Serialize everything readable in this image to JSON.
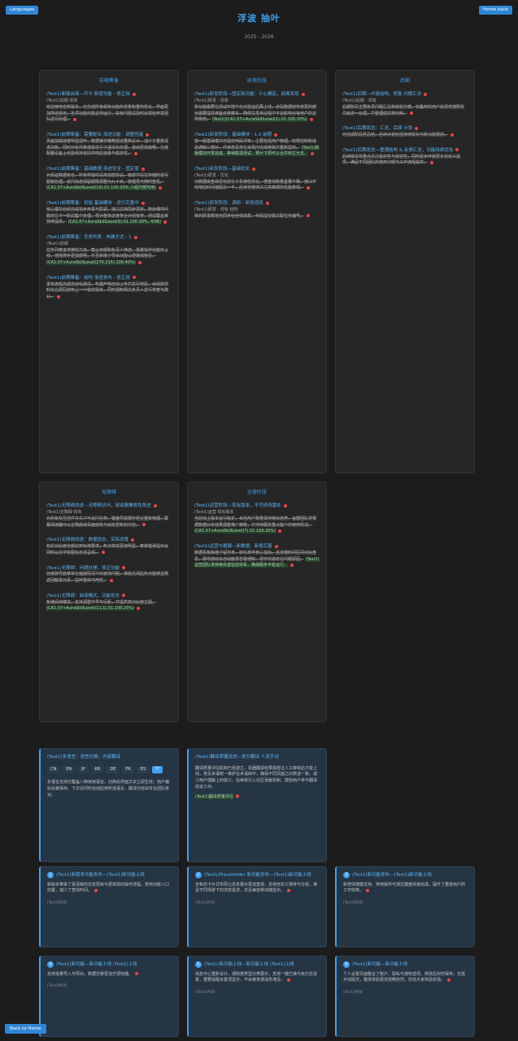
{
  "header": {
    "lang_button": "Languages",
    "home_button": "Home back",
    "title": "浮波 抽叶",
    "subtitle": "2025 - 2026"
  },
  "columns": [
    {
      "title": "前期筹备",
      "entries": [
        {
          "title": "(Test1)新版启用—开今 新增功能 - 修正用",
          "meta": "(Test1)前期 现有",
          "text": "欢迎使用全新版本，已完成所有现有功能的迁移和重构优化，界面更加简洁易用，各项功能均能正常运行，如有问题请及时反馈给开发团队进行处理。",
          "hl": ""
        },
        {
          "title": "(Test1)前期筹备：需要配合 渐进功能 - 调整性能",
          "meta": "",
          "text": "页面加载速度明显提升，数据缓存策略经过重新设计，减少了重复请求次数。同时对长列表渲染进行了虚拟化处理，滚动更加流畅，在低配置设备上也能保持良好的响应速度与稳定性。",
          "hl": ""
        },
        {
          "title": "(Test1)前期筹备：基础数据 渐进安全 - 固定版",
          "meta": "",
          "text": "为保证数据安全，所有传输均采用加密协议，敏感字段在存储时进行脱敏处理，访问日志保留期限调整为九十天，管理员可随时查看。",
          "hl": "(CA1.07+AuraSkillLevel(10).01.100.20%,小组内部可用)"
        },
        {
          "title": "(Test1)前期筹备：初始 基础模块 - 进行完善中",
          "meta": "",
          "text": "核心模块已经完成初步开发与联调，接口文档同步更新。剩余细节问题将在下一阶段集中处理，预计整体进度符合计划安排，测试覆盖率持续提高。",
          "hl": "(CA1.07+AuraSkillLevel(9).01.100.20%, 4/96)"
        },
        {
          "title": "(Test1)前期筹备：任务列表 - 构建方式 - 1",
          "meta": "(Test1)前期",
          "text": "任务列表支持按优先级、截止日期和负责人筛选，批量操作功能已上线，拖拽排序更加顺畅，并且新增了导出功能以便离线查看。",
          "hl": "(CA1.07+AuraSkillLevel(270.215).100.40%)"
        },
        {
          "title": "(Test1)前期筹备：结构 渐进发布 - 修正用",
          "meta": "",
          "text": "发布流程完成自动化改造，构建产物自动上传并进行校验，出现异常时会立即回滚到上一个稳定版本，同时通知相关负责人进行排查与确认。",
          "hl": ""
        }
      ]
    },
    {
      "title": "研发阶段",
      "entries": [
        {
          "title": "(Test1)研发阶段—固定新功能：小心确定，前面发现",
          "meta": "(Test1)研发 - 现有",
          "text": "新功能需要在测试环境中充分验证后再上线，涉及数据结构变更的部分需要提前准备迁移脚本，确保在发布过程中不会影响已有用户的正常使用。",
          "hl": "(Test1)(CA1.07+AuraSkillLevel(1).01.100.20%)"
        },
        {
          "title": "(Test1)研发阶段：基础模块 - 1.0 前期",
          "meta": "",
          "text": "第一版基础模块已提交代码评审，主要包括用户管理、权限控制和消息通知三部分，评审意见将在本周内完成修改并重新提交。",
          "hl": "(Test1)新版模块开发完成，等待联调测试，预计下周可以合并到主分支。"
        },
        {
          "title": "(Test1)研发阶段—基础优化",
          "meta": "(Test1)研发 - 优化",
          "text": "对数据库查询语句进行了系统性优化，慢查询数量显著下降，接口平均响应时间缩短近一半，后续将继续关注高峰期的性能表现。",
          "hl": ""
        },
        {
          "title": "(Test1)研发阶段：调研 - 研发现状",
          "meta": "(Test1)研发 - 现有 结构",
          "text": "新的研发规范已同步给全体成员，代码提交需关联任务编号。",
          "hl": ""
        }
      ]
    },
    {
      "title": "后期",
      "entries": [
        {
          "title": "(Test1)后期—内容结构，修复 问题汇总",
          "meta": "(Test1)后期 - 现有",
          "text": "后期阶段主要负责问题汇总和体验打磨，收集到的用户反馈将按照优先级逐一处理，并整理成文档归档。",
          "hl": ""
        },
        {
          "title": "(Test1)后期状态：汇总，后续 计划",
          "meta": "",
          "text": "已完成阶段性总结，后续计划包括持续优化与新功能规划。",
          "hl": ""
        },
        {
          "title": "(Test1)后期状态—整理结构 & 反馈汇总，功能持续优化",
          "meta": "",
          "text": "后续版本将重点关注稳定性与兼容性，同时逐步开放更多自定义选项，满足不同团队的使用习惯与工作流程需求。",
          "hl": ""
        }
      ]
    },
    {
      "title": "无障碍",
      "entries": [
        {
          "title": "(Test1)无障碍改进—无障碍访问，阅读器兼容性改进",
          "meta": "(Test1)无障碍 现有",
          "text": "为所有交互控件补充了可访问名称，键盘导航顺序经过重新梳理，屏幕阅读器可以正确朗读页面结构与动态更新的内容。",
          "hl": ""
        },
        {
          "title": "(Test1)无障碍改进：数据状态，实际进度",
          "meta": "",
          "text": "色彩对比度全部达到标准要求，焦点样式更加明显，表单错误提示会同时以文字和图标方式呈现。",
          "hl": ""
        },
        {
          "title": "(Test1)无障碍：问题处理，修正功能",
          "meta": "",
          "text": "已修复导航菜单在缩放情况下的遮挡问题，弹窗关闭后焦点能够正确返回触发元素，提升整体可用性。",
          "hl": ""
        },
        {
          "title": "(Test1)无障碍：阅读模式，功能优化",
          "meta": "",
          "text": "新增阅读模式，支持调整字号与行距，并提供高对比度主题。",
          "hl": "(CA1.07+AuraSkillLevel(11.1).01.100.20%)"
        }
      ]
    },
    {
      "title": "运营阶段",
      "entries": [
        {
          "title": "(Test1)运营阶段—现有版本，不可修改版本",
          "meta": "(Test1)运营 现有版本",
          "text": "当前线上版本运行稳定，日活用户数量保持增长态势，运营团队将根据数据分析结果调整推广策略，并持续跟进重点客户的使用情况。",
          "hl": "(CA1.07+AuraSkillLevel(7).01.100.20%)"
        },
        {
          "title": "(Test1)运营与稳健—新数据，新增完善",
          "meta": "",
          "text": "数据看板新增了留存率、转化率等核心指标，支持按时间区间对比查看，异常波动会自动触发告警通知，便于快速定位问题原因。",
          "hl": "(Test1)运营团队将持续完善监控体系，确保服务平稳运行。"
        }
      ]
    }
  ],
  "feature": {
    "left": {
      "title": "(Test1)多语言：语言切换，内容翻译",
      "languages": [
        "CN",
        "EN",
        "JP",
        "KR",
        "DE",
        "FR",
        "ES",
        "IT"
      ],
      "active": "IT",
      "text": "多语言支持已覆盖八种常用语言，切换后界面文本立即生效，用户偏好会被保存，下次访问时自动应用所选语言，翻译内容由专业团队校对。"
    },
    "right": {
      "title": "(Test1)翻译质量改进—提升翻译 人员手动",
      "text": "翻译质量评估机制已经建立，机器翻译结果需经过人工审核后才能上线，常见术语统一维护在术语库中，确保不同页面之间表述一致，减少用户理解上的歧义。后续将引入社区贡献机制，鼓励用户参与翻译改进工作。",
      "hl": "(Test1)翻译质量评估"
    }
  },
  "cards": [
    {
      "num": "1",
      "title": "(Test1)新版本功能发布—(Test1)新功能上线",
      "text": "新版本带来了更清晰的信息层级与更高效的操作流程，常用功能入口前置，减少了查找时间。",
      "time": "(Test1)时间"
    },
    {
      "num": "2",
      "title": "(Test1)Placeholder 新功能发布—(Test1)新功能上线",
      "text": "全新的卡片式布局让信息展示更加直观，支持自定义排序与分组，满足不同场景下的浏览需求，并且兼容移动端显示。",
      "time": "(Test1)时间"
    },
    {
      "num": "3",
      "title": "(Test1)新功能发布—(Test1)新功能上线",
      "text": "新增快捷键支持，常用操作可通过键盘快速完成，提升了重度用户的工作效率。",
      "time": "(Test1)时间"
    },
    {
      "num": "4",
      "title": "(Test1)新功能—新功能上线 (Test1)上线",
      "text": "支持批量导入与导出，数据迁移更加方便快捷。",
      "time": "(Test1)时间"
    },
    {
      "num": "5",
      "title": "(Test1)新功能上线—新功能上线 (Test1)上线",
      "text": "消息中心重新设计，通知按类型分类展示，支持一键已读与免打扰设置，重要提醒会置顶显示，不会被普通消息淹没。",
      "time": "(Test1)时间"
    },
    {
      "num": "6",
      "title": "(Test1)新功能—新功能上线",
      "text": "个人设置页面整合了账户、隐私与通知选项，修改后实时保存，无需手动提交，整体体验更加流畅自然，欢迎大家体验反馈。",
      "time": "(Test1)时间"
    }
  ],
  "footer": {
    "back_button": "Back to Home"
  }
}
